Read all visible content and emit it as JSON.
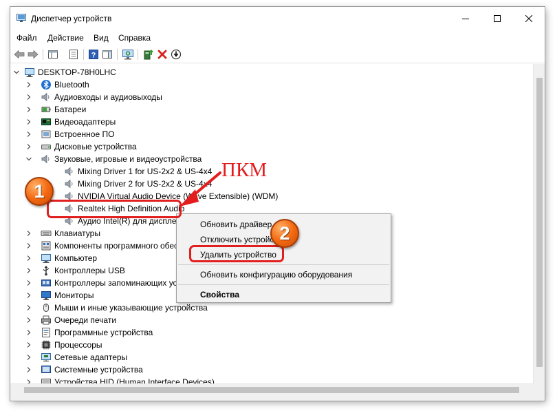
{
  "window": {
    "title": "Диспетчер устройств",
    "controls": [
      "minimize-icon",
      "maximize-icon",
      "close-icon"
    ]
  },
  "menu": [
    "Файл",
    "Действие",
    "Вид",
    "Справка"
  ],
  "toolbar": [
    "back-icon",
    "forward-icon",
    "show-hide-console-tree-icon",
    "properties-icon",
    "help-icon",
    "action-pane-icon",
    "scan-hardware-icon",
    "update-driver-icon",
    "uninstall-icon",
    "disable-icon"
  ],
  "tree": {
    "root": "DESKTOP-78H0LHC",
    "items": [
      {
        "label": "Bluetooth",
        "icon": "bluetooth-icon"
      },
      {
        "label": "Аудиовходы и аудиовыходы",
        "icon": "speaker-icon"
      },
      {
        "label": "Батареи",
        "icon": "battery-icon"
      },
      {
        "label": "Видеоадаптеры",
        "icon": "display-adapter-icon"
      },
      {
        "label": "Встроенное ПО",
        "icon": "firmware-icon"
      },
      {
        "label": "Дисковые устройства",
        "icon": "disk-icon"
      },
      {
        "label": "Звуковые, игровые и видеоустройства",
        "icon": "speaker-icon"
      },
      {
        "label": "Mixing Driver 1 for US-2x2 & US-4x4",
        "icon": "speaker-icon"
      },
      {
        "label": "Mixing Driver 2 for US-2x2 & US-4x4",
        "icon": "speaker-icon"
      },
      {
        "label": "NVIDIA Virtual Audio Device (Wave Extensible) (WDM)",
        "icon": "speaker-icon"
      },
      {
        "label": "Realtek High Definition Audio",
        "icon": "speaker-icon"
      },
      {
        "label": "Аудио Intel(R) для дисплеев",
        "icon": "speaker-icon"
      },
      {
        "label": "Клавиатуры",
        "icon": "keyboard-icon"
      },
      {
        "label": "Компоненты программного обеспечения",
        "icon": "software-component-icon"
      },
      {
        "label": "Компьютер",
        "icon": "computer-icon"
      },
      {
        "label": "Контроллеры USB",
        "icon": "usb-icon"
      },
      {
        "label": "Контроллеры запоминающих устройств",
        "icon": "storage-controller-icon"
      },
      {
        "label": "Мониторы",
        "icon": "monitor-icon"
      },
      {
        "label": "Мыши и иные указывающие устройства",
        "icon": "mouse-icon"
      },
      {
        "label": "Очереди печати",
        "icon": "printer-icon"
      },
      {
        "label": "Программные устройства",
        "icon": "software-device-icon"
      },
      {
        "label": "Процессоры",
        "icon": "processor-icon"
      },
      {
        "label": "Сетевые адаптеры",
        "icon": "network-adapter-icon"
      },
      {
        "label": "Системные устройства",
        "icon": "system-device-icon"
      },
      {
        "label": "Устройства HID (Human Interface Devices)",
        "icon": "hid-icon"
      }
    ]
  },
  "context_menu": {
    "update_driver": "Обновить драйвер",
    "disable_device": "Отключить устройство",
    "uninstall_device": "Удалить устройство",
    "scan_hardware": "Обновить конфигурацию оборудования",
    "properties": "Свойства"
  },
  "annotations": {
    "pkm": "ПКМ",
    "step1": "1",
    "step2": "2",
    "accent_color": "#e21f1f",
    "badge_color": "#f46a12"
  }
}
